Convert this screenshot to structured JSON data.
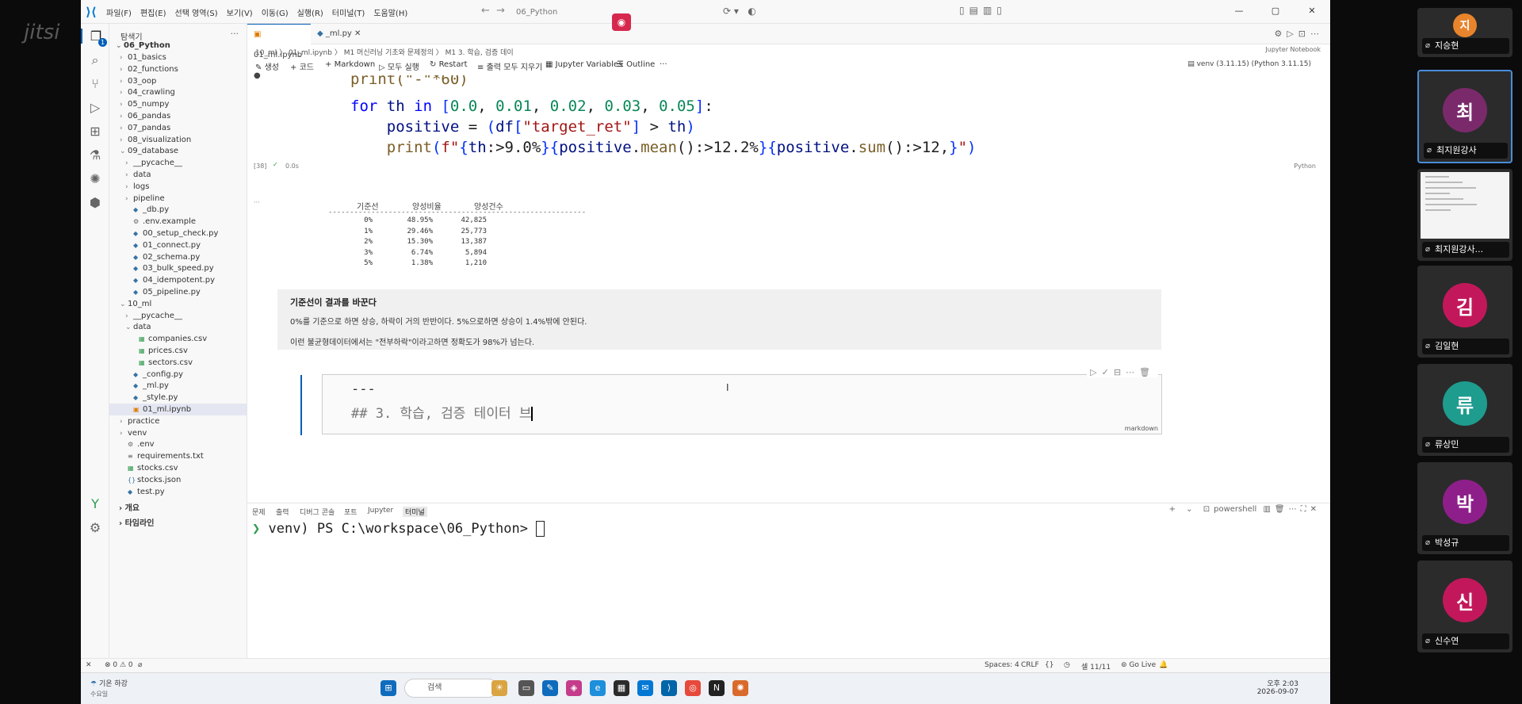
{
  "meeting": {
    "watermark": "jitsi"
  },
  "window": {
    "menu": [
      "파일(F)",
      "편집(E)",
      "선택 영역(S)",
      "보기(V)",
      "이동(G)",
      "실행(R)",
      "터미널(T)",
      "도움말(H)"
    ],
    "search": "06_Python"
  },
  "explorer": {
    "title": "탐색기",
    "root": "06_Python",
    "items": [
      {
        "label": "01_basics",
        "type": "folder",
        "depth": 1
      },
      {
        "label": "02_functions",
        "type": "folder",
        "depth": 1
      },
      {
        "label": "03_oop",
        "type": "folder",
        "depth": 1
      },
      {
        "label": "04_crawling",
        "type": "folder",
        "depth": 1
      },
      {
        "label": "05_numpy",
        "type": "folder",
        "depth": 1
      },
      {
        "label": "06_pandas",
        "type": "folder",
        "depth": 1
      },
      {
        "label": "07_pandas",
        "type": "folder",
        "depth": 1
      },
      {
        "label": "08_visualization",
        "type": "folder",
        "depth": 1
      },
      {
        "label": "09_database",
        "type": "folder-open",
        "depth": 1
      },
      {
        "label": "__pycache__",
        "type": "folder",
        "depth": 2
      },
      {
        "label": "data",
        "type": "folder",
        "depth": 2
      },
      {
        "label": "logs",
        "type": "folder",
        "depth": 2
      },
      {
        "label": "pipeline",
        "type": "folder",
        "depth": 2
      },
      {
        "label": "_db.py",
        "type": "py",
        "depth": 2
      },
      {
        "label": ".env.example",
        "type": "gear",
        "depth": 2
      },
      {
        "label": "00_setup_check.py",
        "type": "py",
        "depth": 2
      },
      {
        "label": "01_connect.py",
        "type": "py",
        "depth": 2
      },
      {
        "label": "02_schema.py",
        "type": "py",
        "depth": 2
      },
      {
        "label": "03_bulk_speed.py",
        "type": "py",
        "depth": 2
      },
      {
        "label": "04_idempotent.py",
        "type": "py",
        "depth": 2
      },
      {
        "label": "05_pipeline.py",
        "type": "py",
        "depth": 2
      },
      {
        "label": "10_ml",
        "type": "folder-open",
        "depth": 1
      },
      {
        "label": "__pycache__",
        "type": "folder",
        "depth": 2
      },
      {
        "label": "data",
        "type": "folder-open",
        "depth": 2
      },
      {
        "label": "companies.csv",
        "type": "csv",
        "depth": 3
      },
      {
        "label": "prices.csv",
        "type": "csv",
        "depth": 3
      },
      {
        "label": "sectors.csv",
        "type": "csv",
        "depth": 3
      },
      {
        "label": "_config.py",
        "type": "py",
        "depth": 2
      },
      {
        "label": "_ml.py",
        "type": "py",
        "depth": 2
      },
      {
        "label": "_style.py",
        "type": "py",
        "depth": 2
      },
      {
        "label": "01_ml.ipynb",
        "type": "nb",
        "depth": 2,
        "selected": true
      },
      {
        "label": "practice",
        "type": "folder",
        "depth": 1
      },
      {
        "label": "venv",
        "type": "folder",
        "depth": 1
      },
      {
        "label": ".env",
        "type": "gear",
        "depth": 1
      },
      {
        "label": "requirements.txt",
        "type": "txt",
        "depth": 1
      },
      {
        "label": "stocks.csv",
        "type": "csv",
        "depth": 1
      },
      {
        "label": "stocks.json",
        "type": "json",
        "depth": 1
      },
      {
        "label": "test.py",
        "type": "py",
        "depth": 1
      }
    ],
    "outline": "개요",
    "timeline": "타임라인"
  },
  "tabs": [
    {
      "label": "01_ml.ipynb",
      "dirty": true,
      "active": true
    },
    {
      "label": "_ml.py",
      "dirty": false,
      "active": false
    }
  ],
  "breadcrumb": "10_ml 〉 01_ml.ipynb 〉 M1 머신러닝 기초와 문제정의 〉 M1 3. 학습, 검증 데이",
  "kernel_label": "Jupyter Notebook",
  "toolbar": {
    "generate": "생성",
    "code": "코드",
    "markdown": "Markdown",
    "run_all": "모두 실행",
    "restart": "Restart",
    "clear": "출력 모두 지우기",
    "variables": "Jupyter Variables",
    "outline": "Outline",
    "venv": "venv (3.11.15) (Python 3.11.15)"
  },
  "code_cell": {
    "line0": "print(\"-\"*60)",
    "exec_count": "[38]",
    "exec_time": "0.0s",
    "language": "Python"
  },
  "output": {
    "headers": [
      "기준선",
      "양성비율",
      "양성건수"
    ],
    "rows": [
      [
        "0%",
        "48.95%",
        "42,825"
      ],
      [
        "1%",
        "29.46%",
        "25,773"
      ],
      [
        "2%",
        "15.30%",
        "13,387"
      ],
      [
        "3%",
        "6.74%",
        "5,894"
      ],
      [
        "5%",
        "1.38%",
        "1,210"
      ]
    ]
  },
  "markdown_cell": {
    "heading": "기준선이 결과를 바꾼다",
    "p1": "0%를 기준으로 하면 상승, 하락이 거의 반반이다. 5%으로하면 상승이 1.4%밖에 안된다.",
    "p2": "이런 불균형데이터에서는 \"전부하락\"이라고하면 정확도가 98%가 넘는다."
  },
  "editing_cell": {
    "line1": "---",
    "line2": "## 3. 학습, 검증 테이터 브",
    "language": "markdown"
  },
  "panel": {
    "tabs": [
      "문제",
      "출력",
      "디버그 콘솔",
      "포트",
      "Jupyter",
      "터미널"
    ],
    "active_tab": "터미널",
    "shell": "powershell",
    "prompt": "venv) PS C:\\workspace\\06_Python> "
  },
  "statusbar": {
    "left": "⊗ 0  ⚠ 0",
    "spaces": "Spaces: 4",
    "eol": "CRLF",
    "braces": "{}",
    "cell": "셀 11/11",
    "golive": "Go Live"
  },
  "taskbar": {
    "weather_line1": "기온 하강",
    "weather_line2": "수요일",
    "search": "검색",
    "time": "오후 2:03",
    "date": "2026-09-07"
  },
  "participants": [
    {
      "initial": "지",
      "name": "지승현",
      "color": "#e8842c"
    },
    {
      "initial": "최",
      "name": "최지원강사",
      "color": "#7a2a6b",
      "active": true
    },
    {
      "initial": "",
      "name": "최지원강사...",
      "color": "#ffffff",
      "screen": true
    },
    {
      "initial": "김",
      "name": "김일현",
      "color": "#c2185b"
    },
    {
      "initial": "류",
      "name": "류상민",
      "color": "#1e9c8e"
    },
    {
      "initial": "박",
      "name": "박성규",
      "color": "#8e1f8a"
    },
    {
      "initial": "신",
      "name": "신수연",
      "color": "#c2185b"
    }
  ]
}
